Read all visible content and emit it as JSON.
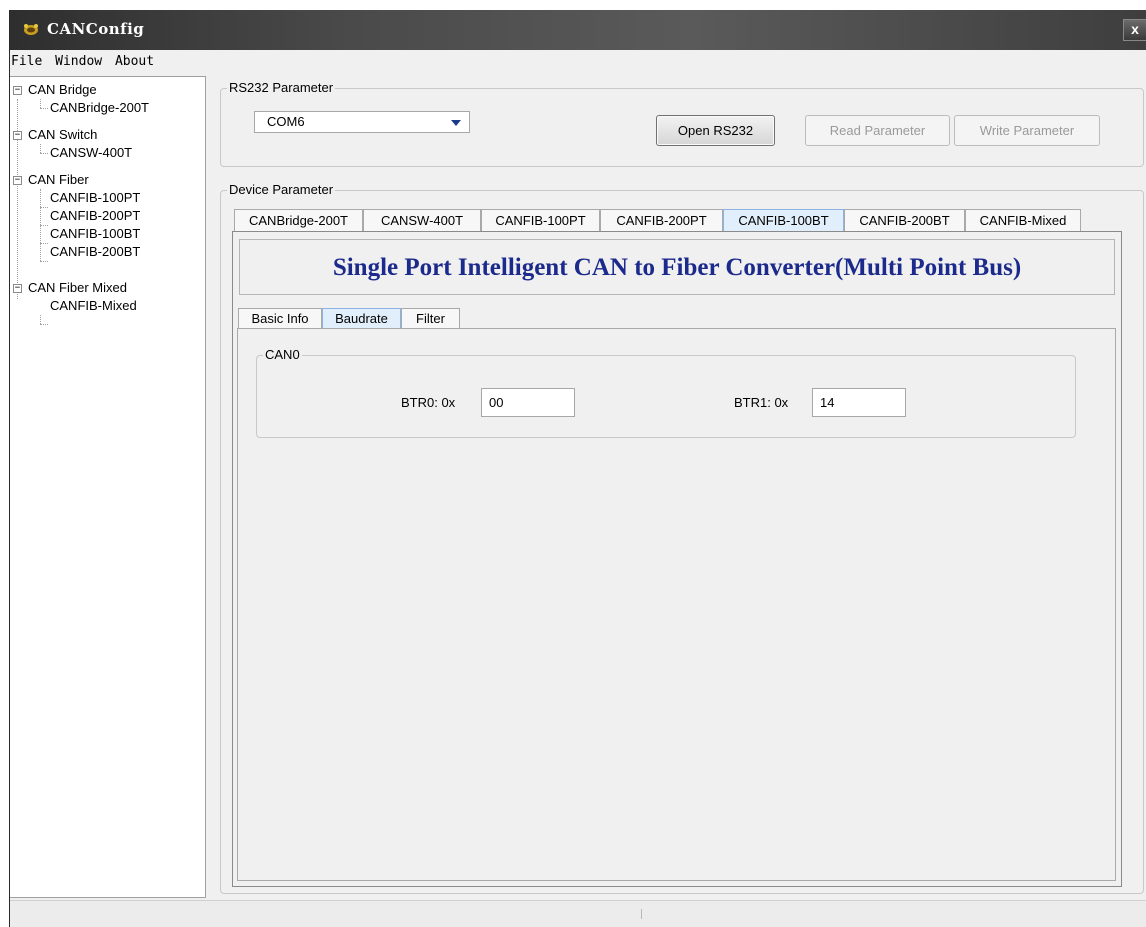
{
  "window": {
    "title": "CANConfig",
    "close_label": "x"
  },
  "menu": {
    "items": [
      "File",
      "Window",
      "About"
    ]
  },
  "tree": {
    "groups": [
      {
        "label": "CAN Bridge",
        "children": [
          "CANBridge-200T"
        ]
      },
      {
        "label": "CAN Switch",
        "children": [
          "CANSW-400T"
        ]
      },
      {
        "label": "CAN Fiber",
        "children": [
          "CANFIB-100PT",
          "CANFIB-200PT",
          "CANFIB-100BT",
          "CANFIB-200BT"
        ]
      },
      {
        "label": "CAN Fiber Mixed",
        "children": [
          "CANFIB-Mixed"
        ]
      }
    ],
    "expander_glyph": "−"
  },
  "rs232": {
    "group_label": "RS232 Parameter",
    "port_value": "COM6",
    "open_label": "Open RS232",
    "read_label": "Read Parameter",
    "write_label": "Write Parameter"
  },
  "device": {
    "group_label": "Device Parameter",
    "tabs": [
      "CANBridge-200T",
      "CANSW-400T",
      "CANFIB-100PT",
      "CANFIB-200PT",
      "CANFIB-100BT",
      "CANFIB-200BT",
      "CANFIB-Mixed"
    ],
    "active_tab": "CANFIB-100BT",
    "banner": "Single Port Intelligent CAN to Fiber Converter(Multi Point Bus)",
    "subtabs": [
      "Basic Info",
      "Baudrate",
      "Filter"
    ],
    "active_subtab": "Baudrate"
  },
  "baudrate": {
    "group_label": "CAN0",
    "btr0_label": "BTR0: 0x",
    "btr0_value": "00",
    "btr1_label": "BTR1: 0x",
    "btr1_value": "14"
  },
  "colors": {
    "banner_text": "#1c2a8c",
    "active_tab_bg": "#e1eefb",
    "combo_arrow": "#1a3a8a"
  }
}
